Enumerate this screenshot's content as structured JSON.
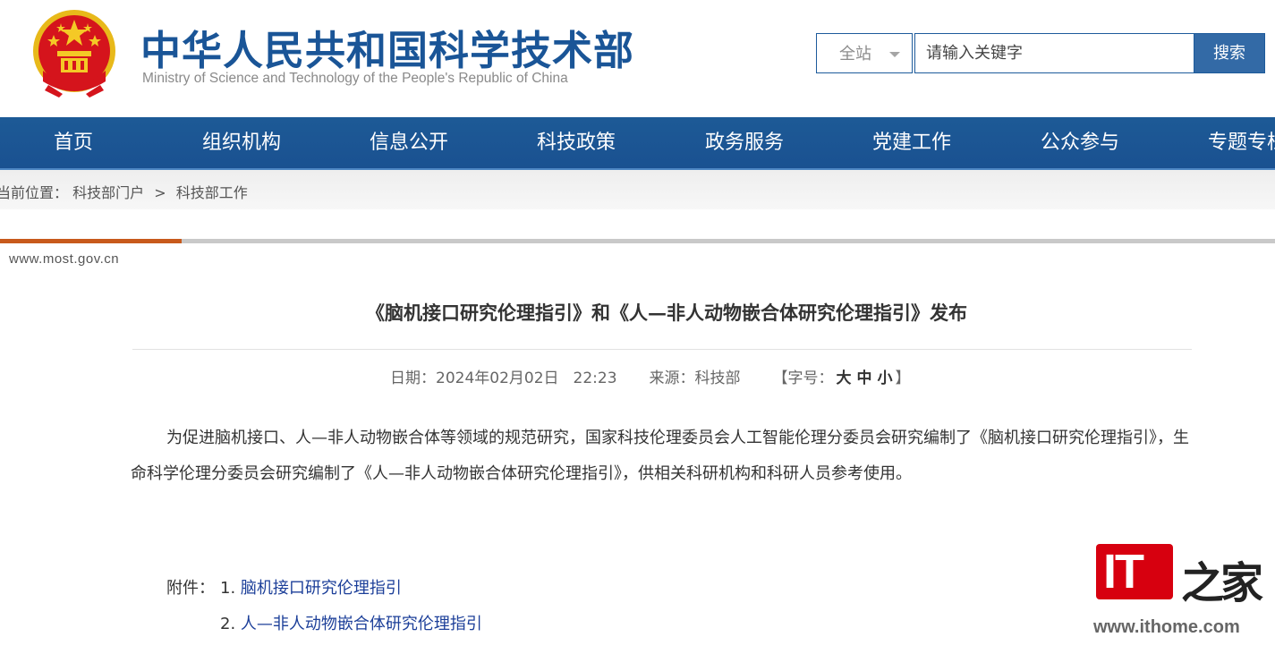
{
  "header": {
    "title_cn": "中华人民共和国科学技术部",
    "title_en": "Ministry of Science and Technology of the People's Republic of China",
    "emblem_icon": "national-emblem-icon"
  },
  "search": {
    "scope_label": "全站",
    "placeholder": "请输入关键字",
    "button_label": "搜索"
  },
  "nav": {
    "items": [
      {
        "label": "首页"
      },
      {
        "label": "组织机构"
      },
      {
        "label": "信息公开"
      },
      {
        "label": "科技政策"
      },
      {
        "label": "政务服务"
      },
      {
        "label": "党建工作"
      },
      {
        "label": "公众参与"
      },
      {
        "label": "专题专栏"
      }
    ]
  },
  "breadcrumb": {
    "prefix": "当前位置：",
    "items": [
      "科技部门户",
      "科技部工作"
    ],
    "separator": ">"
  },
  "site_url": "www.most.gov.cn",
  "article": {
    "title": "《脑机接口研究伦理指引》和《人—非人动物嵌合体研究伦理指引》发布",
    "date_label": "日期：",
    "date": "2024年02月02日",
    "time": "22:23",
    "source_label": "来源：",
    "source": "科技部",
    "font_size_label": "【字号：",
    "font_sizes": [
      "大",
      "中",
      "小"
    ],
    "font_size_close": "】",
    "body": "为促进脑机接口、人—非人动物嵌合体等领域的规范研究，国家科技伦理委员会人工智能伦理分委员会研究编制了《脑机接口研究伦理指引》，生命科学伦理分委员会研究编制了《人—非人动物嵌合体研究伦理指引》，供相关科研机构和科研人员参考使用。",
    "attachments_label": "附件：",
    "attachments": [
      {
        "num": "1.",
        "label": "脑机接口研究伦理指引"
      },
      {
        "num": "2.",
        "label": "人—非人动物嵌合体研究伦理指引"
      }
    ]
  },
  "watermark": {
    "logo_text": "IT",
    "logo_cn": "之家",
    "url": "www.ithome.com"
  },
  "colors": {
    "brand_blue": "#1a5597",
    "nav_blue": "#1d5a96",
    "accent_orange": "#c85a1c",
    "link_blue": "#1c3f99",
    "watermark_red": "#d7000f"
  }
}
